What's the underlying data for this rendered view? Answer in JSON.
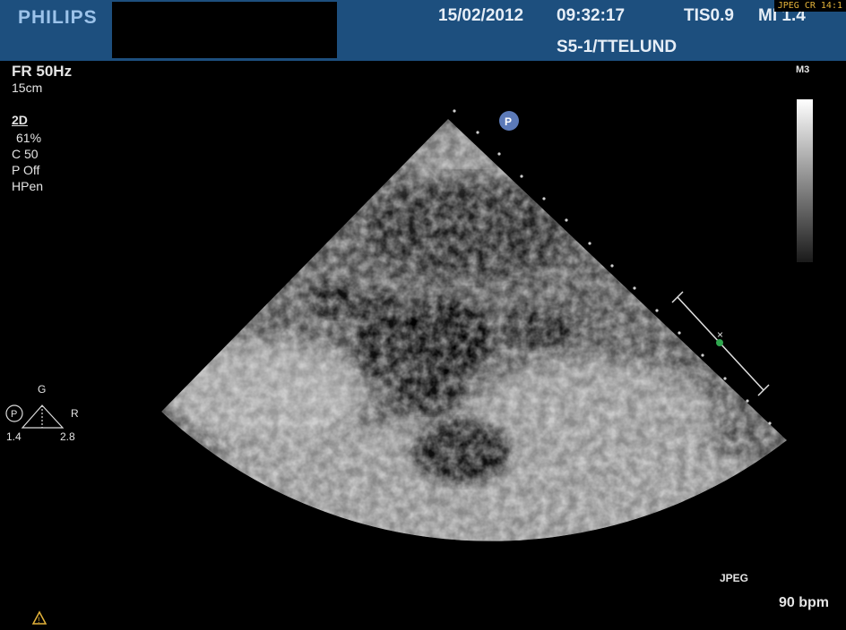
{
  "header": {
    "brand": "PHILIPS",
    "date": "15/02/2012",
    "time": "09:32:17",
    "tis": "TIS0.9",
    "mi": "MI 1.4",
    "probe_preset": "S5-1/TTELUND",
    "compression_badge": "JPEG CR 14:1"
  },
  "left_panel": {
    "frame_rate": "FR 50Hz",
    "depth": "15cm",
    "mode": "2D",
    "gain": "61%",
    "compression": "C 50",
    "persistence": "P Off",
    "harmonics": "HPen"
  },
  "orientation": {
    "g_label": "G",
    "r_label": "R",
    "p_label": "P",
    "left_value": "1.4",
    "right_value": "2.8"
  },
  "right_panel": {
    "map": "M3",
    "format": "JPEG",
    "heart_rate": "90 bpm"
  },
  "icons": {
    "marker": "probe-orientation-p-icon",
    "warning": "warning-triangle-icon"
  },
  "colors": {
    "header_bg": "#1d4f7e",
    "badge_text": "#e5b43a",
    "focus_dot": "#2fa84f"
  }
}
